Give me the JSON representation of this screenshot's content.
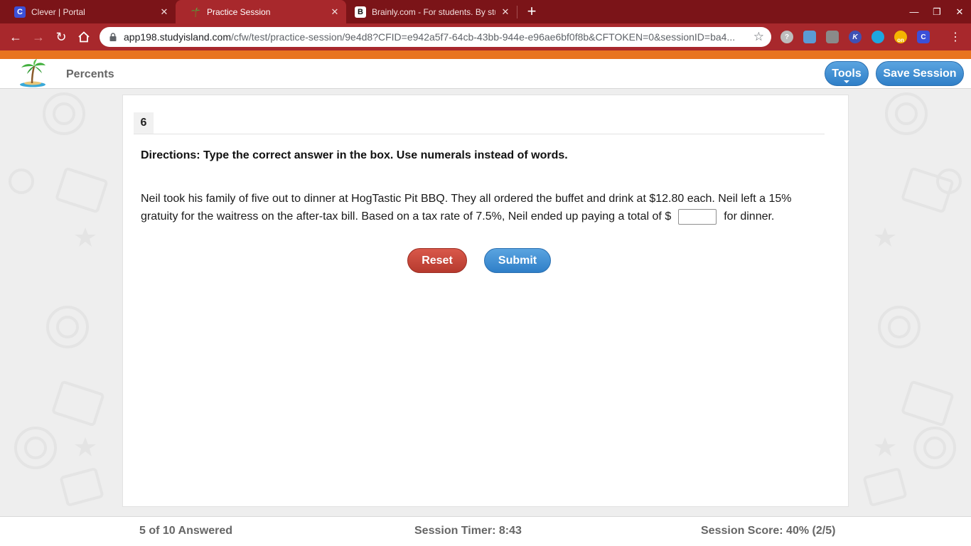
{
  "browser": {
    "tabs": [
      {
        "title": "Clever | Portal",
        "favicon": "C",
        "active": false
      },
      {
        "title": "Practice Session",
        "favicon": "palm-tree",
        "active": true
      },
      {
        "title": "Brainly.com - For students. By students.",
        "favicon": "B",
        "active": false
      }
    ],
    "new_tab": "+",
    "url_host": "app198.studyisland.com",
    "url_path": "/cfw/test/practice-session/9e4d8?CFID=e942a5f7-64cb-43bb-944e-e96ae6bf0f8b&CFTOKEN=0&sessionID=ba4...",
    "extensions": [
      {
        "name": "help-extension-icon",
        "label": "?",
        "color": "#9e9e9e"
      },
      {
        "name": "profile-extension-icon",
        "label": "",
        "color": "#5b9bd5"
      },
      {
        "name": "copy-extension-icon",
        "label": "",
        "color": "#8a8a8a"
      },
      {
        "name": "k-extension-icon",
        "label": "K",
        "color": "#3f51b5"
      },
      {
        "name": "vpn-extension-icon",
        "label": "",
        "color": "#1ea7e0"
      },
      {
        "name": "on-extension-icon",
        "label": "on",
        "color": "#f4b400"
      },
      {
        "name": "clever-extension-icon",
        "label": "C",
        "color": "#3c50d8"
      }
    ]
  },
  "colors": {
    "tabbar": "#7b1418",
    "toolbar": "#a8282c",
    "accent_orange": "#e8741f",
    "primary_blue": "#3b8ad4",
    "reset_red": "#c94a3c"
  },
  "app": {
    "section_title": "Percents",
    "tools_label": "Tools",
    "save_session_label": "Save Session"
  },
  "question": {
    "number": "6",
    "directions": "Directions: Type the correct answer in the box.  Use numerals instead of words.",
    "text_before": "Neil took his family of five out to dinner at HogTastic Pit BBQ.  They all ordered the buffet and drink at $12.80 each.  Neil left a 15% gratuity for the waitress on the after-tax bill.  Based on a tax rate of 7.5%, Neil ended up paying a total of $",
    "answer_value": "",
    "text_after": "for dinner.",
    "reset_label": "Reset",
    "submit_label": "Submit"
  },
  "footer": {
    "answered": "5 of 10 Answered",
    "timer": "Session Timer: 8:43",
    "score": "Session Score: 40% (2/5)"
  }
}
